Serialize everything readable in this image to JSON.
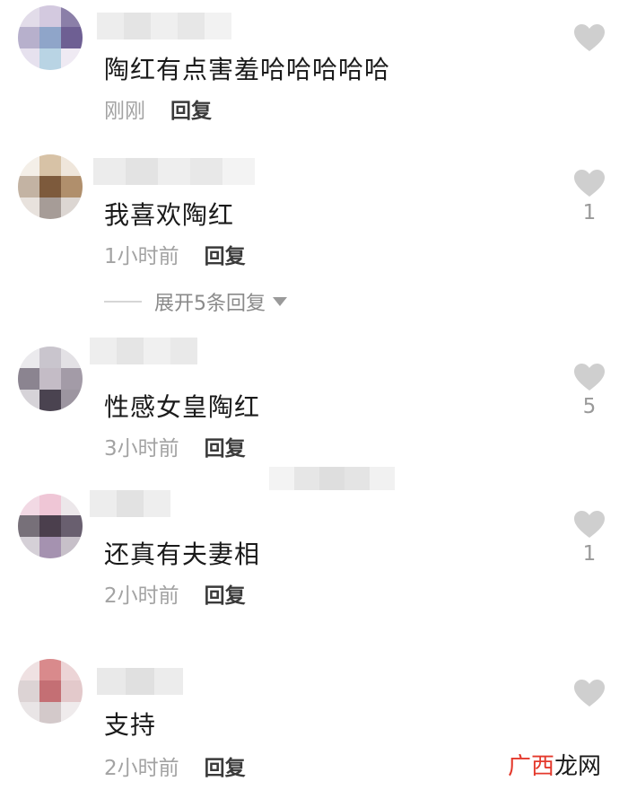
{
  "comments": [
    {
      "text": "陶红有点害羞哈哈哈哈哈",
      "time": "刚刚",
      "reply": "回复",
      "likes": "",
      "avatar": [
        "#e2dce9",
        "#d3c9df",
        "#8b7fa8",
        "#b7b0cc",
        "#8fa5c9",
        "#6e5f93",
        "#e6e1ee",
        "#b9d4e4",
        "#efeaf3"
      ]
    },
    {
      "text": "我喜欢陶红",
      "time": "1小时前",
      "reply": "回复",
      "likes": "1",
      "avatar": [
        "#f4efe8",
        "#d7c2a6",
        "#efe6db",
        "#c3b3a3",
        "#7d5a3c",
        "#b08f6c",
        "#e8e2dd",
        "#a69c97",
        "#dcd6d2"
      ]
    },
    {
      "text": "性感女皇陶红",
      "time": "3小时前",
      "reply": "回复",
      "likes": "5",
      "avatar": [
        "#ebeaed",
        "#c9c5cd",
        "#e3e1e5",
        "#8b8490",
        "#c4bcc6",
        "#a39ba7",
        "#d6d3d8",
        "#4a4350",
        "#9c95a0"
      ]
    },
    {
      "text": "还真有夫妻相",
      "time": "2小时前",
      "reply": "回复",
      "likes": "1",
      "avatar": [
        "#f2d9e4",
        "#efc6d6",
        "#ece7ea",
        "#777079",
        "#4b3f4d",
        "#695f6f",
        "#d5d0d7",
        "#a592b0",
        "#c7c0c9"
      ]
    },
    {
      "text": "支持",
      "time": "2小时前",
      "reply": "回复",
      "likes": "",
      "avatar": [
        "#efe1e2",
        "#d98a8c",
        "#ecd4d6",
        "#dcd3d4",
        "#c46f74",
        "#e3c9cb",
        "#e9e5e6",
        "#d3c9ca",
        "#efebec"
      ]
    }
  ],
  "expand_label": "展开5条回复",
  "watermark": {
    "red": "广西",
    "black": "龙网"
  },
  "colors": {
    "like_heart": "#cfcfcf",
    "time": "#a3a3a3",
    "reply": "#3a3a3a",
    "text": "#1a1a1a"
  }
}
